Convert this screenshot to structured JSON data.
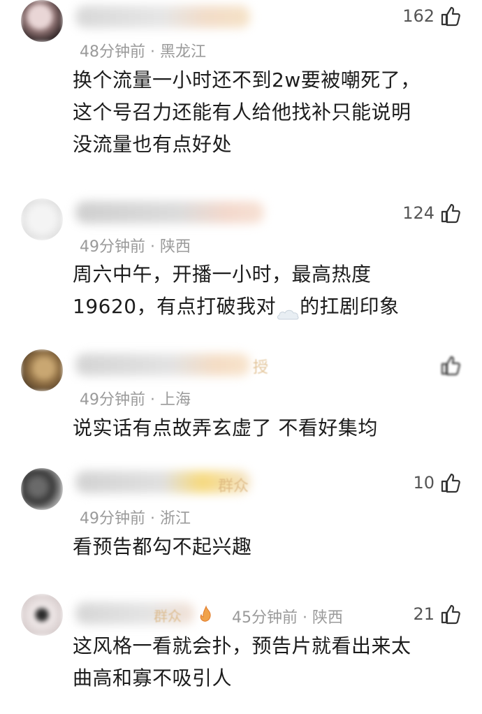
{
  "comments": [
    {
      "meta": "48分钟前 · 黑龙江",
      "likes": "162",
      "lines": [
        "换个流量一小时还不到2w要被嘲死了，",
        "这个号召力还能有人给他找补只能说明",
        "没流量也有点好处"
      ]
    },
    {
      "meta": "49分钟前 · 陕西",
      "likes": "124",
      "line1": "周六中午，开播一小时，最高热度",
      "line2_before": "19620，有点打破我对",
      "line2_emoji": "cloud-emoji",
      "line2_after": "的扛剧印象"
    },
    {
      "meta": "49分钟前 · 上海",
      "likes": "",
      "badge": "授",
      "lines": [
        "说实话有点故弄玄虚了 不看好集均"
      ]
    },
    {
      "meta": "49分钟前 · 浙江",
      "likes": "10",
      "badge": "群众",
      "lines": [
        "看预告都勾不起兴趣"
      ]
    },
    {
      "meta": "45分钟前 · 陕西",
      "likes": "21",
      "badge": "群众",
      "badge_icon": "fire-emoji",
      "lines": [
        "这风格一看就会扑，预告片就看出来太",
        "曲高和寡不吸引人"
      ]
    }
  ],
  "icons": {
    "like": "thumbs-up-icon"
  },
  "colors": {
    "meta_text": "#9a9a9a",
    "body_text": "#1c1c1c",
    "badge_text": "#d9b27a"
  }
}
